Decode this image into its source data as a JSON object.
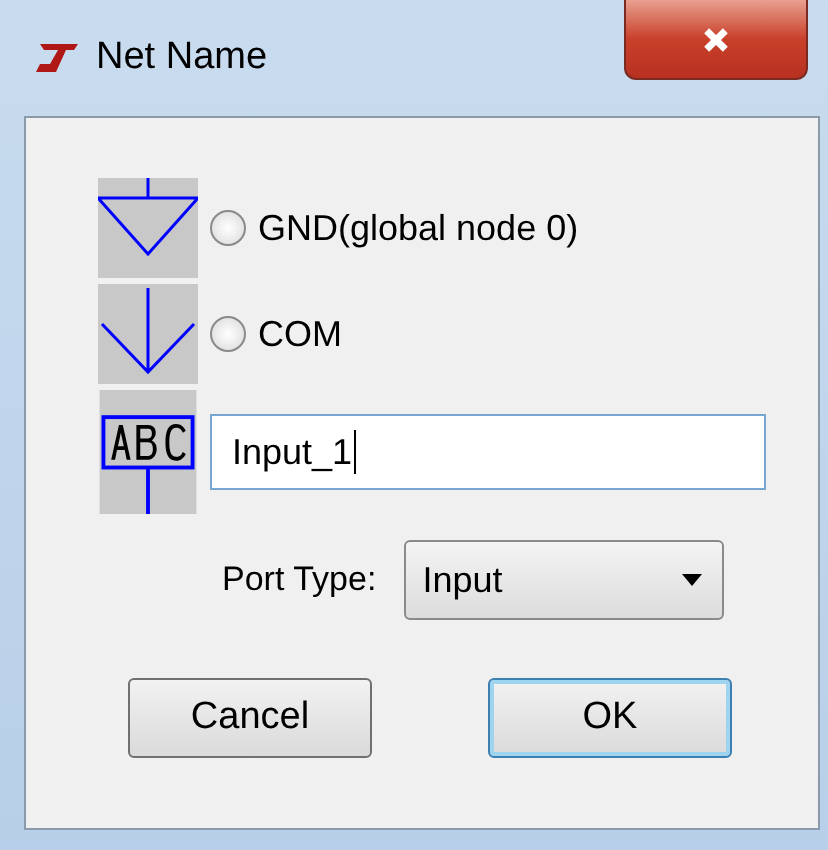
{
  "window": {
    "title": "Net Name"
  },
  "options": [
    {
      "kind": "gnd",
      "label": "GND(global node 0)",
      "selected": false
    },
    {
      "kind": "com",
      "label": "COM",
      "selected": false
    }
  ],
  "name_field": {
    "value": "Input_1"
  },
  "port_type": {
    "label": "Port Type:",
    "value": "Input"
  },
  "buttons": [
    {
      "label": "Cancel",
      "default": false
    },
    {
      "label": "OK",
      "default": true
    }
  ]
}
